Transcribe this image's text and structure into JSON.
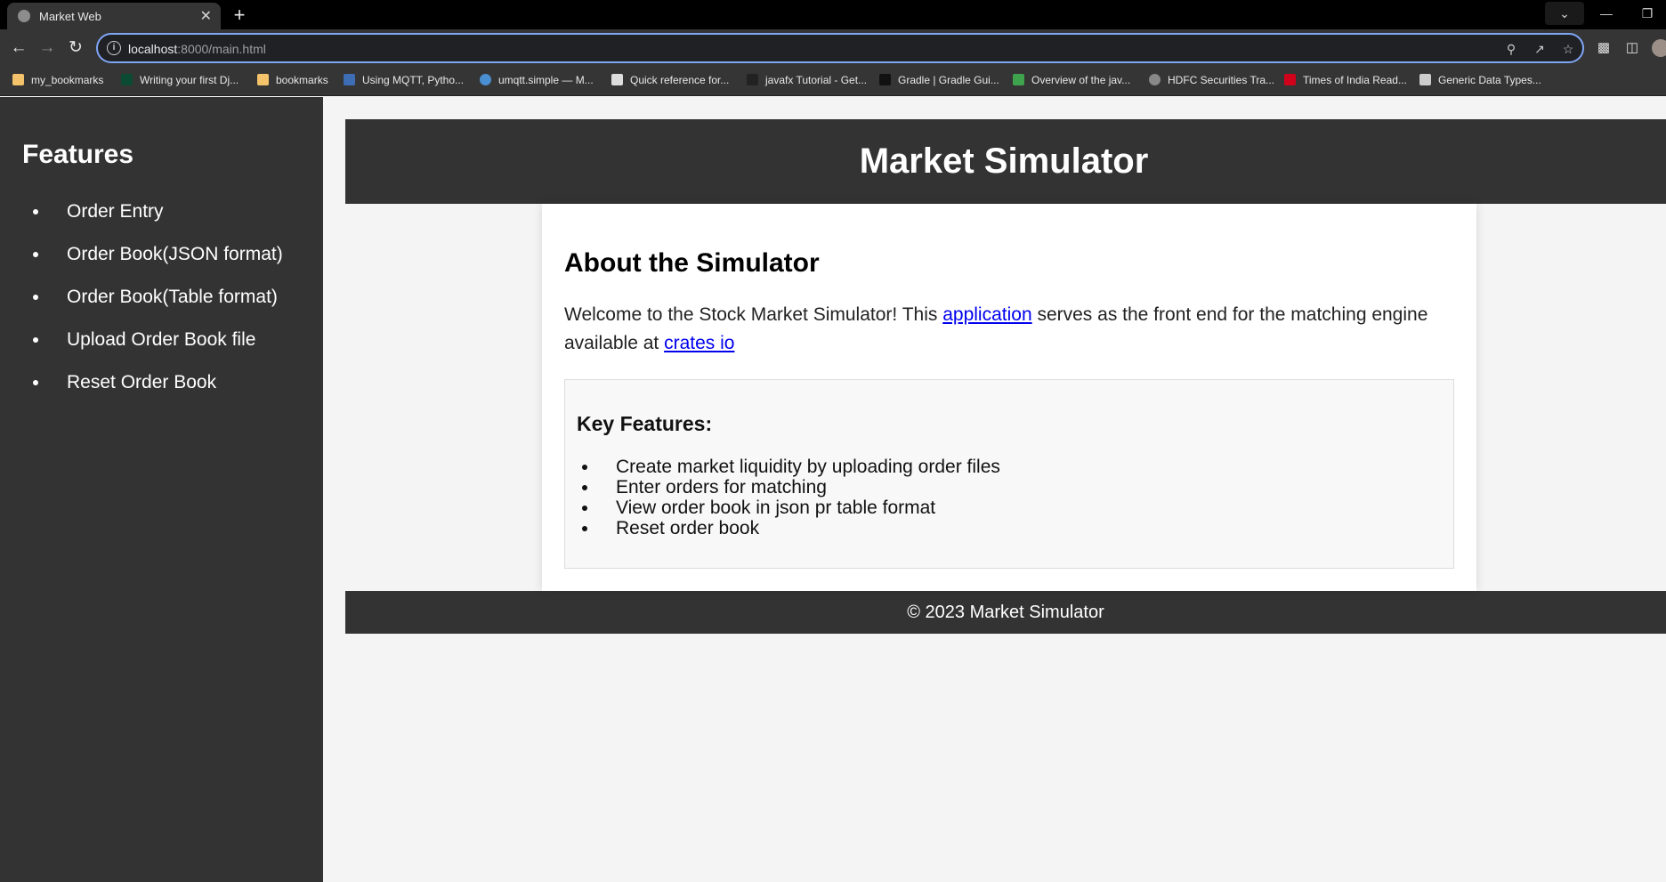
{
  "browser": {
    "tab_title": "Market Web",
    "tab_close": "✕",
    "new_tab": "+",
    "url_host": "localhost",
    "url_rest": ":8000/main.html",
    "bookmarks": [
      {
        "label": "my_bookmarks",
        "icon": "folder-icon"
      },
      {
        "label": "Writing your first Dj...",
        "icon": "django-icon"
      },
      {
        "label": "bookmarks",
        "icon": "folder-icon"
      },
      {
        "label": "Using MQTT, Pytho...",
        "icon": "site-icon"
      },
      {
        "label": "umqtt.simple — M...",
        "icon": "link-icon"
      },
      {
        "label": "Quick reference for...",
        "icon": "doc-icon"
      },
      {
        "label": "javafx Tutorial - Get...",
        "icon": "site-icon"
      },
      {
        "label": "Gradle | Gradle Gui...",
        "icon": "gradle-icon"
      },
      {
        "label": "Overview of the jav...",
        "icon": "site-icon"
      },
      {
        "label": "HDFC Securities Tra...",
        "icon": "globe-icon"
      },
      {
        "label": "Times of India Read...",
        "icon": "toi-icon"
      },
      {
        "label": "Generic Data Types...",
        "icon": "book-icon"
      }
    ]
  },
  "sidebar": {
    "title": "Features",
    "items": [
      "Order Entry",
      "Order Book(JSON format)",
      "Order Book(Table format)",
      "Upload Order Book file",
      "Reset Order Book"
    ]
  },
  "header": {
    "title": "Market Simulator"
  },
  "about": {
    "heading": "About the Simulator",
    "text_before": "Welcome to the Stock Market Simulator! This ",
    "link1": "application",
    "text_middle": " serves as the front end for the matching engine available at ",
    "link2": "crates io"
  },
  "key_features": {
    "heading": "Key Features:",
    "items": [
      "Create market liquidity by uploading order files",
      "Enter orders for matching",
      "View order book in json pr table format",
      "Reset order book"
    ]
  },
  "footer": {
    "text": "© 2023 Market Simulator"
  },
  "colors": {
    "dark": "#333333",
    "link": "#0000ee",
    "page_bg": "#f4f4f4"
  }
}
